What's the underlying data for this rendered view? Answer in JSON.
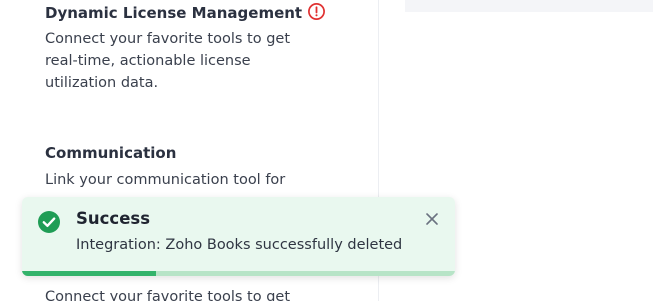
{
  "sections": [
    {
      "title": "Dynamic License Management",
      "description_lines": [
        "Connect your favorite tools to get",
        "real-time, actionable license",
        "utilization data."
      ]
    },
    {
      "title": "Communication",
      "description_lines": [
        "Link your communication tool for"
      ]
    },
    {
      "description_lines": [
        "Connect your favorite tools to get"
      ]
    }
  ],
  "icons": {
    "warning": "warning-circle-icon",
    "success": "check-circle-icon",
    "close": "close-icon"
  },
  "toast": {
    "title": "Success",
    "message": "Integration: Zoho Books successfully deleted",
    "progress": 0.31
  },
  "colors": {
    "success": "#1f9d55",
    "toast_bg": "#e9f8ef",
    "progress": "#34b36b",
    "progress_track": "#b7e4c7",
    "warning": "#e03131"
  }
}
